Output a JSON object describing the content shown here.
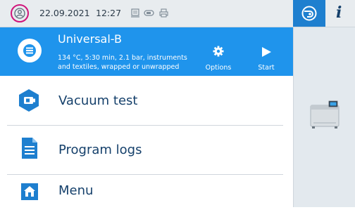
{
  "status_bar": {
    "date": "22.09.2021",
    "time": "12:27",
    "user_icon": "user-circle-icon",
    "status_icons": [
      "log-document-icon",
      "usb-stick-icon",
      "printer-icon"
    ],
    "accent_color": "#d0147a"
  },
  "tabs": {
    "sterilizer_icon": "sterilizer-tab-icon",
    "info_label": "i"
  },
  "program": {
    "title": "Universal-B",
    "description_line1": "134 °C, 5:30 min, 2.1 bar, instruments",
    "description_line2": "and textiles, wrapped or unwrapped",
    "options_label": "Options",
    "start_label": "Start",
    "background_color": "#1f94ec"
  },
  "menu": {
    "items": [
      {
        "label": "Vacuum test",
        "icon": "vacuum-test-icon"
      },
      {
        "label": "Program logs",
        "icon": "document-icon"
      },
      {
        "label": "Menu",
        "icon": "home-icon"
      }
    ]
  },
  "colors": {
    "text_dark_blue": "#15406b",
    "icon_blue": "#1e7fcf"
  }
}
